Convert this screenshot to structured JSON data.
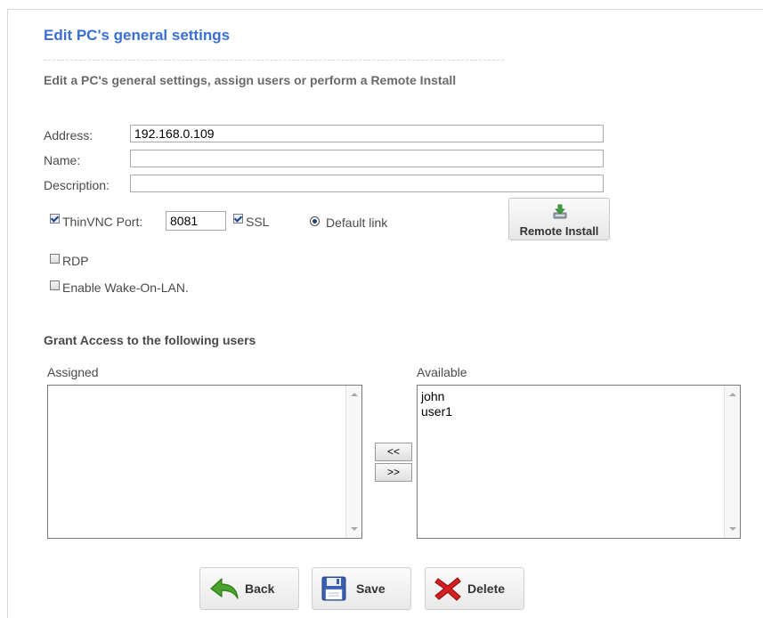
{
  "header": {
    "title": "Edit PC's general settings",
    "subtitle": "Edit a PC's general settings, assign users or perform a Remote Install"
  },
  "form": {
    "address_label": "Address:",
    "address_value": "192.168.0.109",
    "name_label": "Name:",
    "name_value": "",
    "description_label": "Description:",
    "description_value": "",
    "thinvnc": {
      "label": "ThinVNC Port:",
      "checked": true,
      "port_value": "8081"
    },
    "ssl": {
      "label": "SSL",
      "checked": true
    },
    "default_link": {
      "label": "Default link",
      "selected": true
    },
    "rdp": {
      "label": "RDP",
      "checked": false
    },
    "wol": {
      "label": "Enable Wake-On-LAN.",
      "checked": false
    },
    "remote_install_label": "Remote Install"
  },
  "users": {
    "section_title": "Grant Access to the following users",
    "assigned_label": "Assigned",
    "assigned_items": [],
    "available_label": "Available",
    "available_items": [
      "john",
      "user1"
    ],
    "move_left_label": "<<",
    "move_right_label": ">>"
  },
  "actions": {
    "back_label": "Back",
    "save_label": "Save",
    "delete_label": "Delete"
  },
  "colors": {
    "title": "#3a6fd8",
    "back_icon": "#4aa32a",
    "save_icon": "#3a5fb0",
    "delete_icon": "#d42020"
  },
  "icons": {
    "remote_install": "download-tray-icon",
    "back": "back-arrow-icon",
    "save": "floppy-disk-icon",
    "delete": "red-x-icon"
  }
}
